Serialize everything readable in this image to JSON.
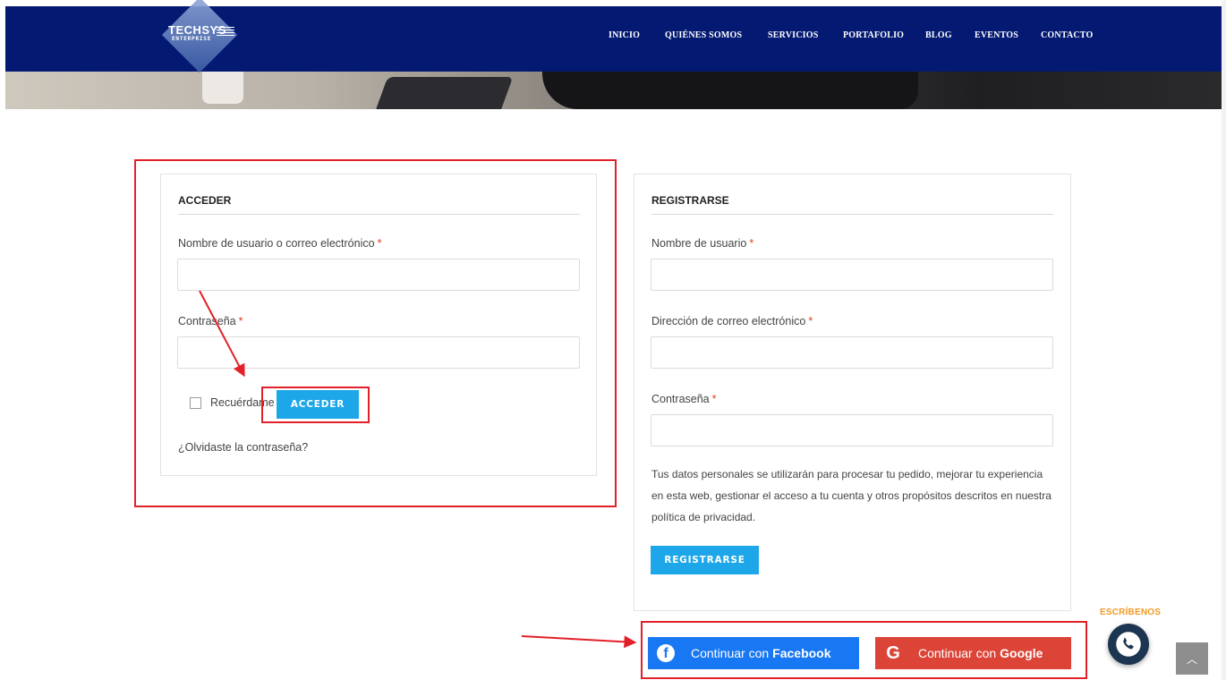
{
  "brand": {
    "name": "TECHSYS",
    "tagline": "ENTERPRISE"
  },
  "nav": [
    "INICIO",
    "QUIÉNES SOMOS",
    "SERVICIOS",
    "PORTAFOLIO",
    "BLOG",
    "EVENTOS",
    "CONTACTO"
  ],
  "login": {
    "title": "ACCEDER",
    "username_label": "Nombre de usuario o correo electrónico",
    "username_value": "",
    "password_label": "Contraseña",
    "password_value": "",
    "remember_label": "Recuérdame",
    "remember_checked": false,
    "submit_label": "ACCEDER",
    "forgot_label": "¿Olvidaste la contraseña?"
  },
  "register": {
    "title": "REGISTRARSE",
    "username_label": "Nombre de usuario",
    "username_value": "",
    "email_label": "Dirección de correo electrónico",
    "email_value": "",
    "password_label": "Contraseña",
    "password_value": "",
    "privacy_text": "Tus datos personales se utilizarán para procesar tu pedido, mejorar tu experiencia en esta web, gestionar el acceso a tu cuenta y otros propósitos descritos en nuestra política de privacidad.",
    "submit_label": "REGISTRARSE"
  },
  "required_mark": "*",
  "social": {
    "facebook_prefix": "Continuar con",
    "facebook_name": "Facebook",
    "google_prefix": "Continuar con",
    "google_name": "Google"
  },
  "whatsapp": {
    "label": "ESCRÍBENOS"
  },
  "colors": {
    "header": "#041a72",
    "accent": "#1ea7e8",
    "annotation": "#e2202a",
    "facebook": "#1877f2",
    "google": "#db4437",
    "whatsapp_label": "#f39a21"
  },
  "icons": {
    "facebook": "facebook-icon",
    "google": "google-icon",
    "whatsapp": "whatsapp-icon",
    "scroll_top": "chevron-up-icon"
  }
}
